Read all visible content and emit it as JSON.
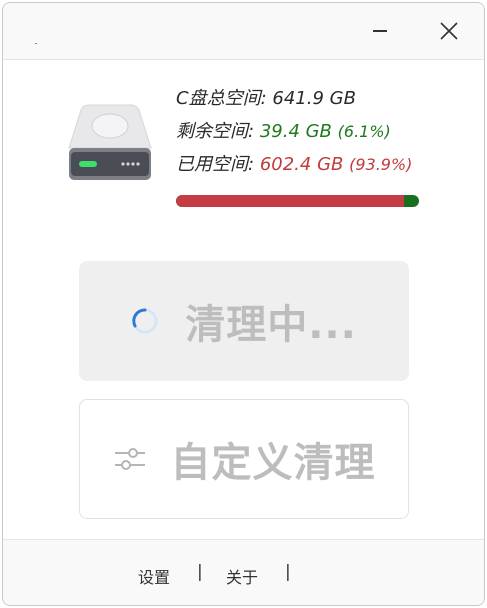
{
  "window": {
    "title": "",
    "minimize_icon": "minimize-icon",
    "close_icon": "close-icon"
  },
  "disk": {
    "icon": "hard-drive-icon",
    "total_label": "C盘总空间:",
    "total_value": "641.9 GB",
    "free_label": "剩余空间:",
    "free_value": "39.4 GB",
    "free_pct": "(6.1%)",
    "used_label": "已用空间:",
    "used_value": "602.4 GB",
    "used_pct": "(93.9%)",
    "used_fraction": 0.939,
    "colors": {
      "used": "#c43c44",
      "free": "#18701f"
    }
  },
  "actions": {
    "clean_label": "清理中...",
    "clean_icon": "loading-spinner-icon",
    "custom_label": "自定义清理",
    "custom_icon": "sliders-icon"
  },
  "footer": {
    "settings_label": "设置",
    "sep1": "|",
    "about_label": "关于",
    "sep2": "|"
  }
}
